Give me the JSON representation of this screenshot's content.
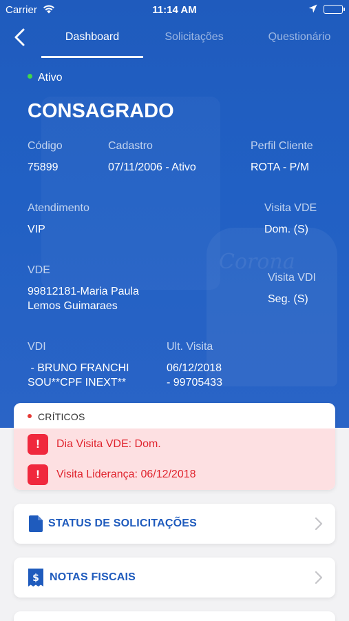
{
  "status_bar": {
    "carrier": "Carrier",
    "time": "11:14 AM"
  },
  "nav": {
    "tabs": [
      {
        "label": "Dashboard",
        "active": true
      },
      {
        "label": "Solicitações",
        "active": false
      },
      {
        "label": "Questionário",
        "active": false
      }
    ]
  },
  "client": {
    "status": "Ativo",
    "name": "CONSAGRADO",
    "fields": {
      "codigo": {
        "label": "Código",
        "value": "75899"
      },
      "cadastro": {
        "label": "Cadastro",
        "value": "07/11/2006 - Ativo"
      },
      "perfil": {
        "label": "Perfil Cliente",
        "value": "ROTA - P/M"
      },
      "atendimento": {
        "label": "Atendimento",
        "value": "VIP"
      },
      "visita_vde": {
        "label": "Visita VDE",
        "value": "Dom. (S)"
      },
      "vde": {
        "label": "VDE",
        "value_line1": "99812181-Maria Paula",
        "value_line2": "Lemos Guimaraes"
      },
      "visita_vdi": {
        "label": "Visita VDI",
        "value": "Seg. (S)"
      },
      "vdi": {
        "label": "VDI",
        "value_line1": " - BRUNO FRANCHI",
        "value_line2": "SOU**CPF INEXT**"
      },
      "ult_visita": {
        "label": "Ult. Visita",
        "value_line1": "06/12/2018",
        "value_line2": "- 99705433"
      }
    }
  },
  "criticos": {
    "title": "CRÍTICOS",
    "items": [
      {
        "icon": "!",
        "text": "Dia Visita VDE: Dom."
      },
      {
        "icon": "!",
        "text": "Visita Liderança: 06/12/2018"
      }
    ]
  },
  "menu": [
    {
      "label": "STATUS DE SOLICITAÇÕES",
      "icon": "document-icon"
    },
    {
      "label": "NOTAS FISCAIS",
      "icon": "receipt-icon"
    }
  ],
  "colors": {
    "primary": "#1f5bbd",
    "active_dot": "#41d64b",
    "critical_red": "#f0283d",
    "critical_bg": "#fde0e2"
  }
}
